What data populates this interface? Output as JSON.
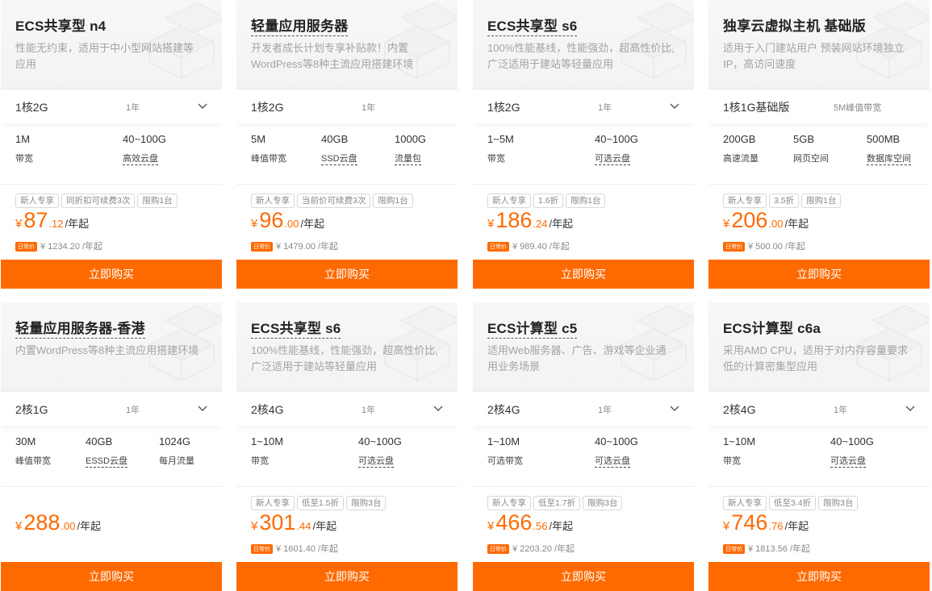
{
  "colors": {
    "accent": "#ff6a00",
    "muted": "#a3a3a3"
  },
  "cards": [
    {
      "title": "ECS共享型 n4",
      "desc": "性能无约束，适用于中小型网站搭建等应用",
      "spec": "1核2G",
      "period": "1年",
      "features": [
        {
          "v": "1M",
          "l": "带宽"
        },
        {
          "v": "40~100G",
          "l": "高效云盘"
        }
      ],
      "tags": [
        "新人专享",
        "同折扣可续费3次",
        "限购1台"
      ],
      "currency": "¥",
      "int": "87",
      "dec": ".12",
      "unit": "/年起",
      "badge": "日常价",
      "orig": "¥ 1234.20 /年起",
      "button": "立即购买"
    },
    {
      "title": "轻量应用服务器",
      "desc": "开发者成长计划专享补贴款！内置WordPress等8种主流应用搭建环境",
      "spec": "1核2G",
      "period": "1年",
      "features": [
        {
          "v": "5M",
          "l": "峰值带宽"
        },
        {
          "v": "40GB",
          "l": "SSD云盘"
        },
        {
          "v": "1000G",
          "l": "流量包"
        }
      ],
      "tags": [
        "新人专享",
        "当前价可续费3次",
        "限购1台"
      ],
      "currency": "¥",
      "int": "96",
      "dec": ".00",
      "unit": "/年起",
      "badge": "日常价",
      "orig": "¥ 1479.00 /年起",
      "button": "立即购买"
    },
    {
      "title": "ECS共享型 s6",
      "desc": "100%性能基线，性能强劲，超高性价比,广泛适用于建站等轻量应用",
      "spec": "1核2G",
      "period": "1年",
      "features": [
        {
          "v": "1~5M",
          "l": "带宽"
        },
        {
          "v": "40~100G",
          "l": "可选云盘"
        }
      ],
      "tags": [
        "新人专享",
        "1.6折",
        "限购1台"
      ],
      "currency": "¥",
      "int": "186",
      "dec": ".24",
      "unit": "/年起",
      "badge": "日常价",
      "orig": "¥ 989.40 /年起",
      "button": "立即购买"
    },
    {
      "title": "独享云虚拟主机 基础版",
      "desc": "适用于入门建站用户 预装网站环境独立IP，高访问速度",
      "spec": "1核1G基础版",
      "period": "5M峰值带宽",
      "features": [
        {
          "v": "200GB",
          "l": "高速流量"
        },
        {
          "v": "5GB",
          "l": "网页空间"
        },
        {
          "v": "500MB",
          "l": "数据库空间"
        }
      ],
      "tags": [
        "新人专享",
        "3.5折",
        "限购1台"
      ],
      "currency": "¥",
      "int": "206",
      "dec": ".00",
      "unit": "/年起",
      "badge": "日常价",
      "orig": "¥ 500.00 /年起",
      "button": "立即购买"
    },
    {
      "title": "轻量应用服务器-香港",
      "desc": "内置WordPress等8种主流应用搭建环境",
      "spec": "2核1G",
      "period": "1年",
      "features": [
        {
          "v": "30M",
          "l": "峰值带宽"
        },
        {
          "v": "40GB",
          "l": "ESSD云盘"
        },
        {
          "v": "1024G",
          "l": "每月流量"
        }
      ],
      "tags": [],
      "currency": "¥",
      "int": "288",
      "dec": ".00",
      "unit": "/年起",
      "badge": "",
      "orig": "",
      "button": "立即购买"
    },
    {
      "title": "ECS共享型 s6",
      "desc": "100%性能基线，性能强劲，超高性价比,广泛适用于建站等轻量应用",
      "spec": "2核4G",
      "period": "1年",
      "features": [
        {
          "v": "1~10M",
          "l": "带宽"
        },
        {
          "v": "40~100G",
          "l": "可选云盘"
        }
      ],
      "tags": [
        "新人专享",
        "低至1.5折",
        "限购3台"
      ],
      "currency": "¥",
      "int": "301",
      "dec": ".44",
      "unit": "/年起",
      "badge": "日常价",
      "orig": "¥ 1601.40 /年起",
      "button": "立即购买"
    },
    {
      "title": "ECS计算型 c5",
      "desc": "适用Web服务器、广告、游戏等企业通用业务场景",
      "spec": "2核4G",
      "period": "1年",
      "features": [
        {
          "v": "1~10M",
          "l": "可选带宽"
        },
        {
          "v": "40~100G",
          "l": "可选云盘"
        }
      ],
      "tags": [
        "新人专享",
        "低至1.7折",
        "限购3台"
      ],
      "currency": "¥",
      "int": "466",
      "dec": ".56",
      "unit": "/年起",
      "badge": "日常价",
      "orig": "¥ 2203.20 /年起",
      "button": "立即购买"
    },
    {
      "title": "ECS计算型 c6a",
      "desc": "采用AMD CPU，适用于对内存容量要求低的计算密集型应用",
      "spec": "2核4G",
      "period": "1年",
      "features": [
        {
          "v": "1~10M",
          "l": "带宽"
        },
        {
          "v": "40~100G",
          "l": "可选云盘"
        }
      ],
      "tags": [
        "新人专享",
        "低至3.4折",
        "限购3台"
      ],
      "currency": "¥",
      "int": "746",
      "dec": ".76",
      "unit": "/年起",
      "badge": "日常价",
      "orig": "¥ 1813.56 /年起",
      "button": "立即购买"
    }
  ]
}
